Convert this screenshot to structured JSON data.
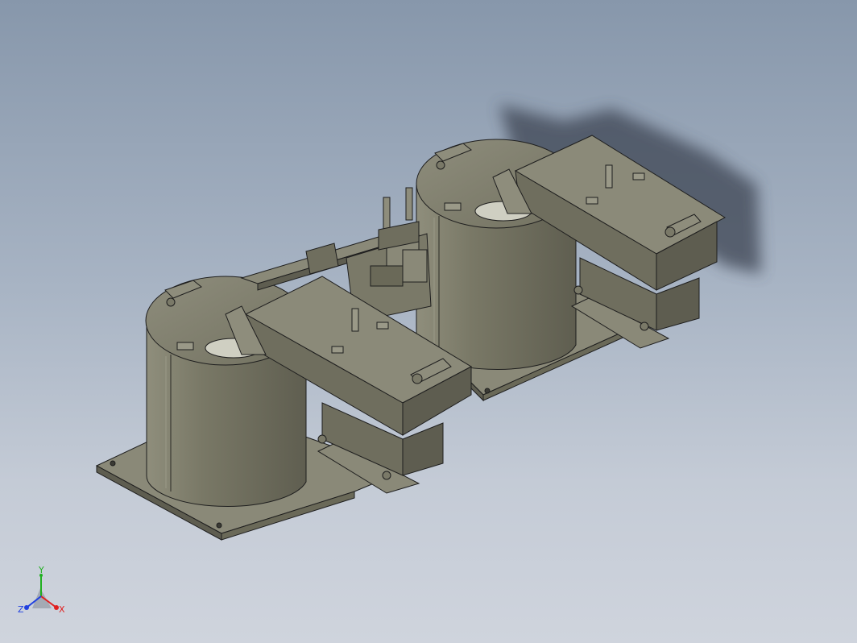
{
  "triad": {
    "y_label": "Y",
    "x_label": "X",
    "z_label": "Z",
    "colors": {
      "x": "#e02020",
      "y": "#20b020",
      "z": "#2040e0"
    }
  },
  "model": {
    "body_color": "#7d7c6b",
    "edge_color": "#1e1e1e",
    "highlight_color": "#9a9988",
    "shadow_color": "#4a4e58"
  }
}
